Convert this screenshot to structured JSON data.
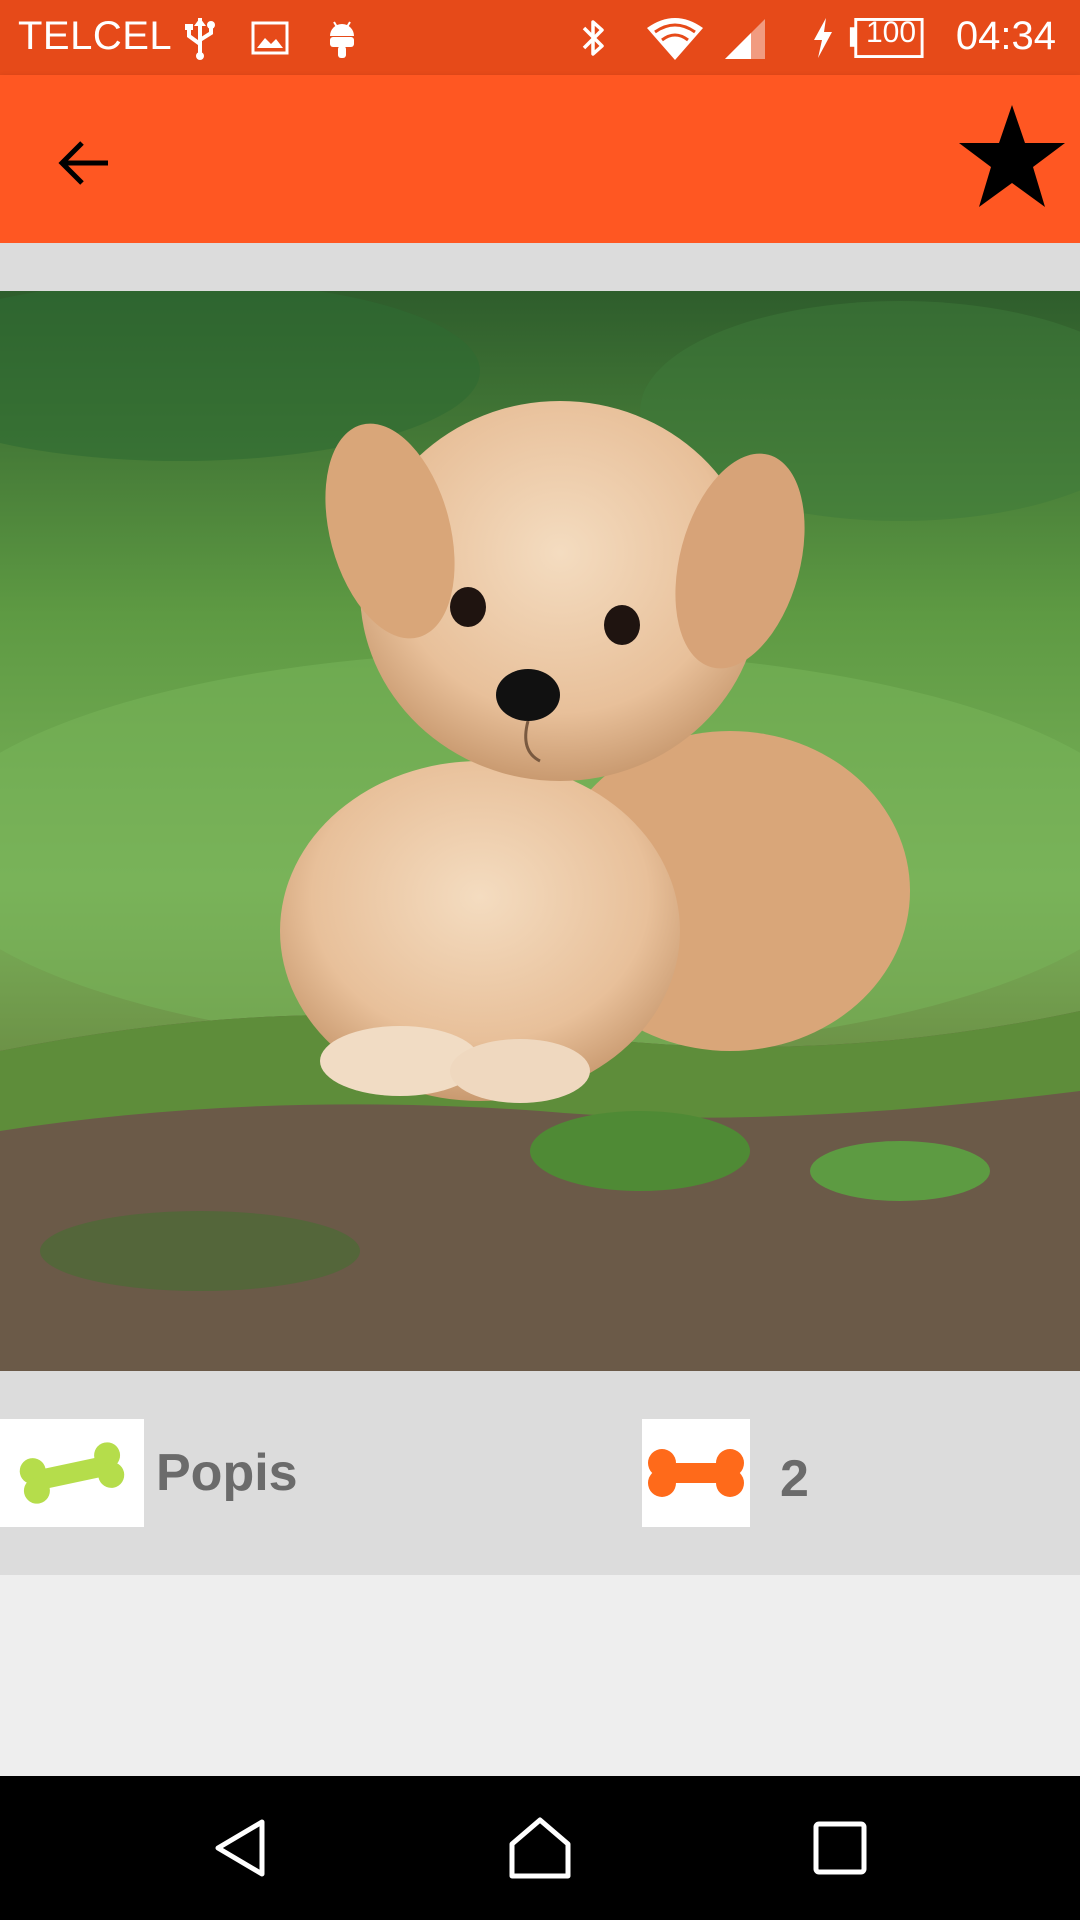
{
  "status_bar": {
    "carrier": "TELCEL",
    "battery_level": "100",
    "time": "04:34",
    "icons": [
      "usb-icon",
      "image-icon",
      "android-icon",
      "bluetooth-icon",
      "wifi-icon",
      "signal-icon",
      "charging-icon",
      "battery-icon"
    ]
  },
  "app_bar": {
    "back_icon": "arrow-left-icon",
    "favorite_icon": "star-icon"
  },
  "photo": {
    "subject": "puppy"
  },
  "info": {
    "name": "Popis",
    "count": "2",
    "left_icon": "bone-icon",
    "right_icon": "bone-icon"
  },
  "nav_bar": {
    "icons": [
      "nav-back-icon",
      "nav-home-icon",
      "nav-recents-icon"
    ]
  },
  "colors": {
    "status_bar": "#e64a19",
    "app_bar": "#ff5722",
    "bone_green": "#b5dd4b",
    "bone_orange": "#ff6a1a",
    "text_gray": "#6b6b6b"
  }
}
